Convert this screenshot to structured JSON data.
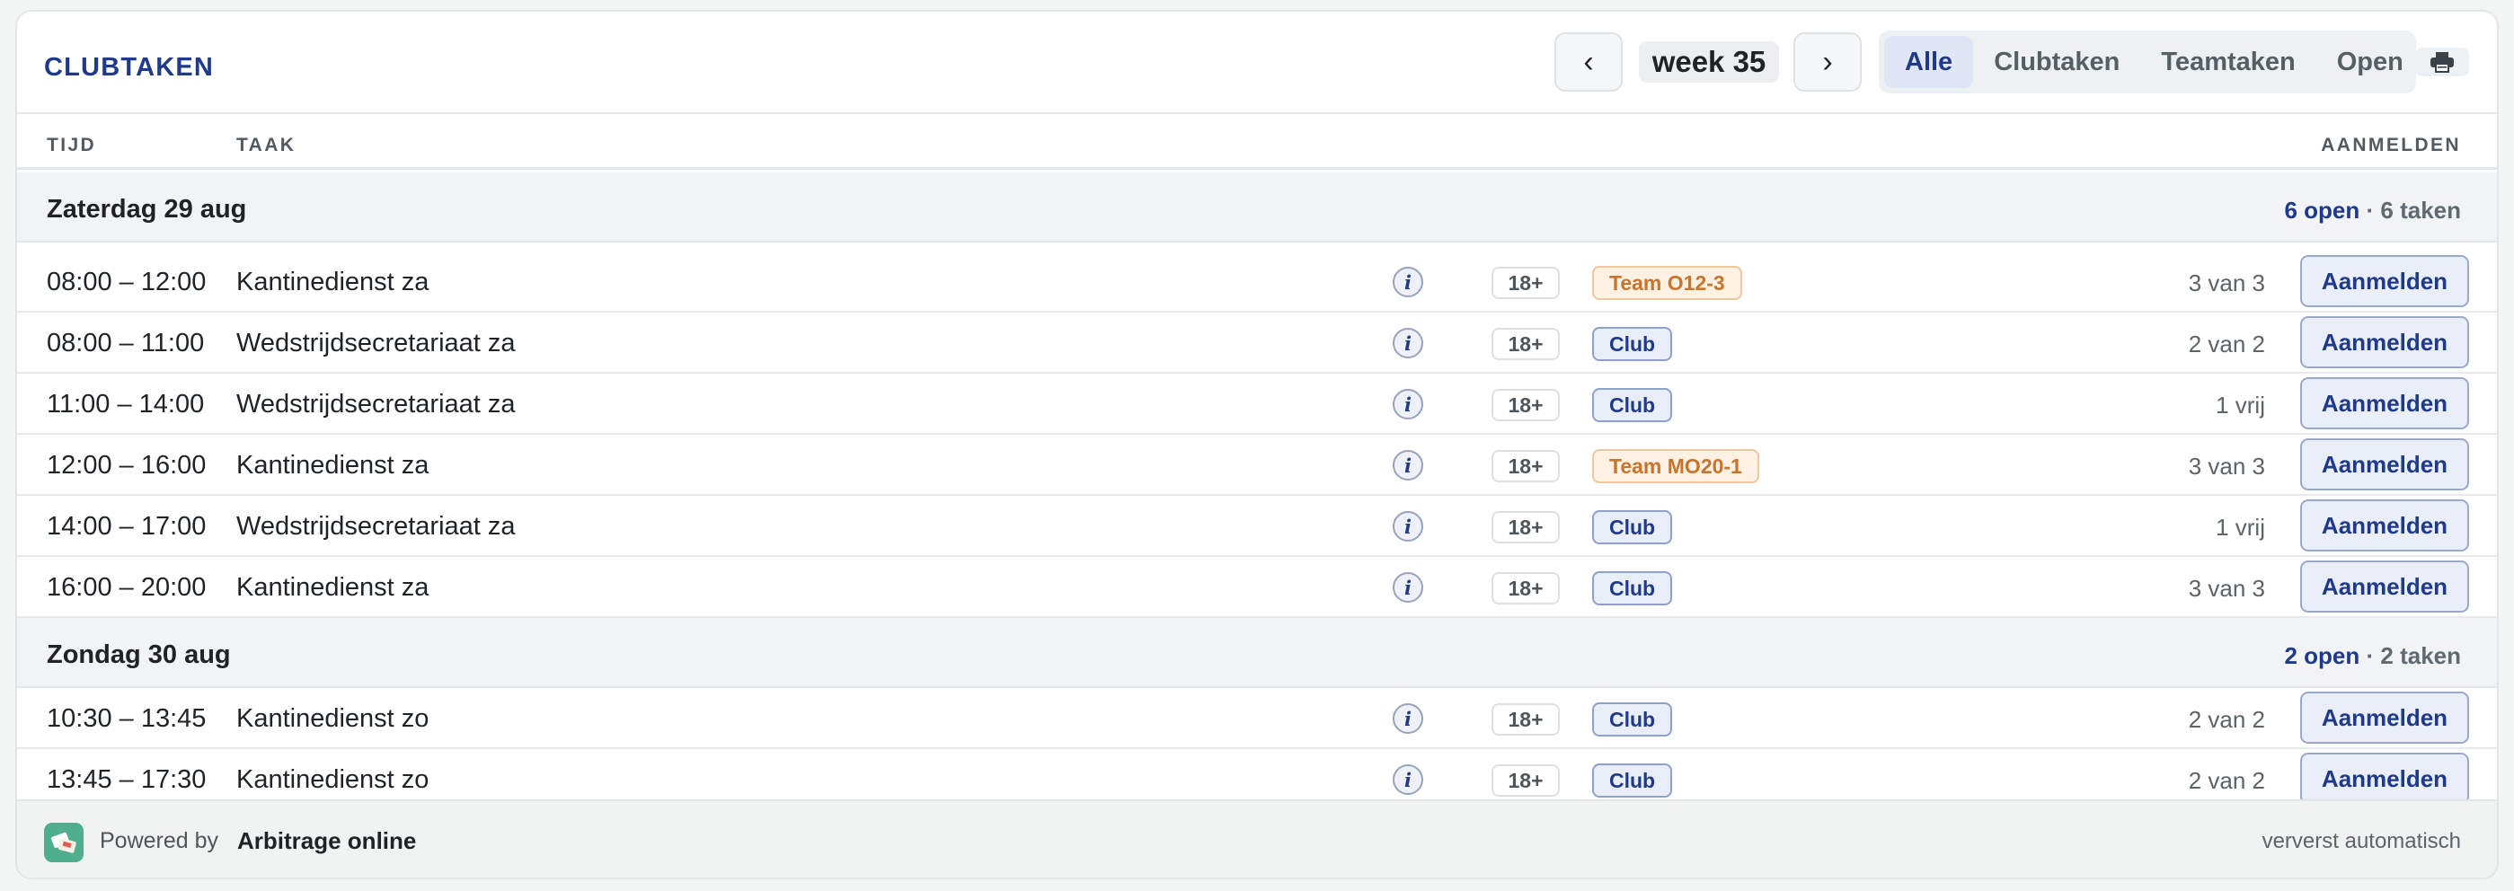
{
  "header": {
    "title": "CLUBTAKEN",
    "prev_icon": "‹",
    "week": "week 35",
    "next_icon": "›",
    "filters": [
      {
        "label": "Alle",
        "active": true
      },
      {
        "label": "Clubtaken",
        "active": false
      },
      {
        "label": "Teamtaken",
        "active": false
      },
      {
        "label": "Open",
        "active": false
      }
    ],
    "print_icon": "printer-icon"
  },
  "columns": {
    "time": "TIJD",
    "task": "TAAK",
    "signup": "AANMELDEN"
  },
  "days": [
    {
      "name": "Zaterdag 29 aug",
      "open": "6 open",
      "sep": " · ",
      "total": "6 taken",
      "tasks": [
        {
          "time": "08:00 – 12:00",
          "task": "Kantinedienst za",
          "info": "i",
          "age": "18+",
          "badge": "Team O12-3",
          "badge_type": "team",
          "availability": "3 van 3",
          "button": "Aanmelden"
        },
        {
          "time": "08:00 – 11:00",
          "task": "Wedstrijdsecretariaat za",
          "info": "i",
          "age": "18+",
          "badge": "Club",
          "badge_type": "club",
          "availability": "2 van 2",
          "button": "Aanmelden"
        },
        {
          "time": "11:00 – 14:00",
          "task": "Wedstrijdsecretariaat za",
          "info": "i",
          "age": "18+",
          "badge": "Club",
          "badge_type": "club",
          "availability": "1 vrij",
          "button": "Aanmelden"
        },
        {
          "time": "12:00 – 16:00",
          "task": "Kantinedienst za",
          "info": "i",
          "age": "18+",
          "badge": "Team MO20-1",
          "badge_type": "team",
          "availability": "3 van 3",
          "button": "Aanmelden"
        },
        {
          "time": "14:00 – 17:00",
          "task": "Wedstrijdsecretariaat za",
          "info": "i",
          "age": "18+",
          "badge": "Club",
          "badge_type": "club",
          "availability": "1 vrij",
          "button": "Aanmelden"
        },
        {
          "time": "16:00 – 20:00",
          "task": "Kantinedienst za",
          "info": "i",
          "age": "18+",
          "badge": "Club",
          "badge_type": "club",
          "availability": "3 van 3",
          "button": "Aanmelden"
        }
      ]
    },
    {
      "name": "Zondag 30 aug",
      "open": "2 open",
      "sep": " · ",
      "total": "2 taken",
      "tasks": [
        {
          "time": "10:30 – 13:45",
          "task": "Kantinedienst zo",
          "info": "i",
          "age": "18+",
          "badge": "Club",
          "badge_type": "club",
          "availability": "2 van 2",
          "button": "Aanmelden"
        },
        {
          "time": "13:45 – 17:30",
          "task": "Kantinedienst zo",
          "info": "i",
          "age": "18+",
          "badge": "Club",
          "badge_type": "club",
          "availability": "2 van 2",
          "button": "Aanmelden"
        }
      ]
    }
  ],
  "footer": {
    "powered_by": "Powered by",
    "brand": "Arbitrage online",
    "refresh": "ververst automatisch"
  }
}
